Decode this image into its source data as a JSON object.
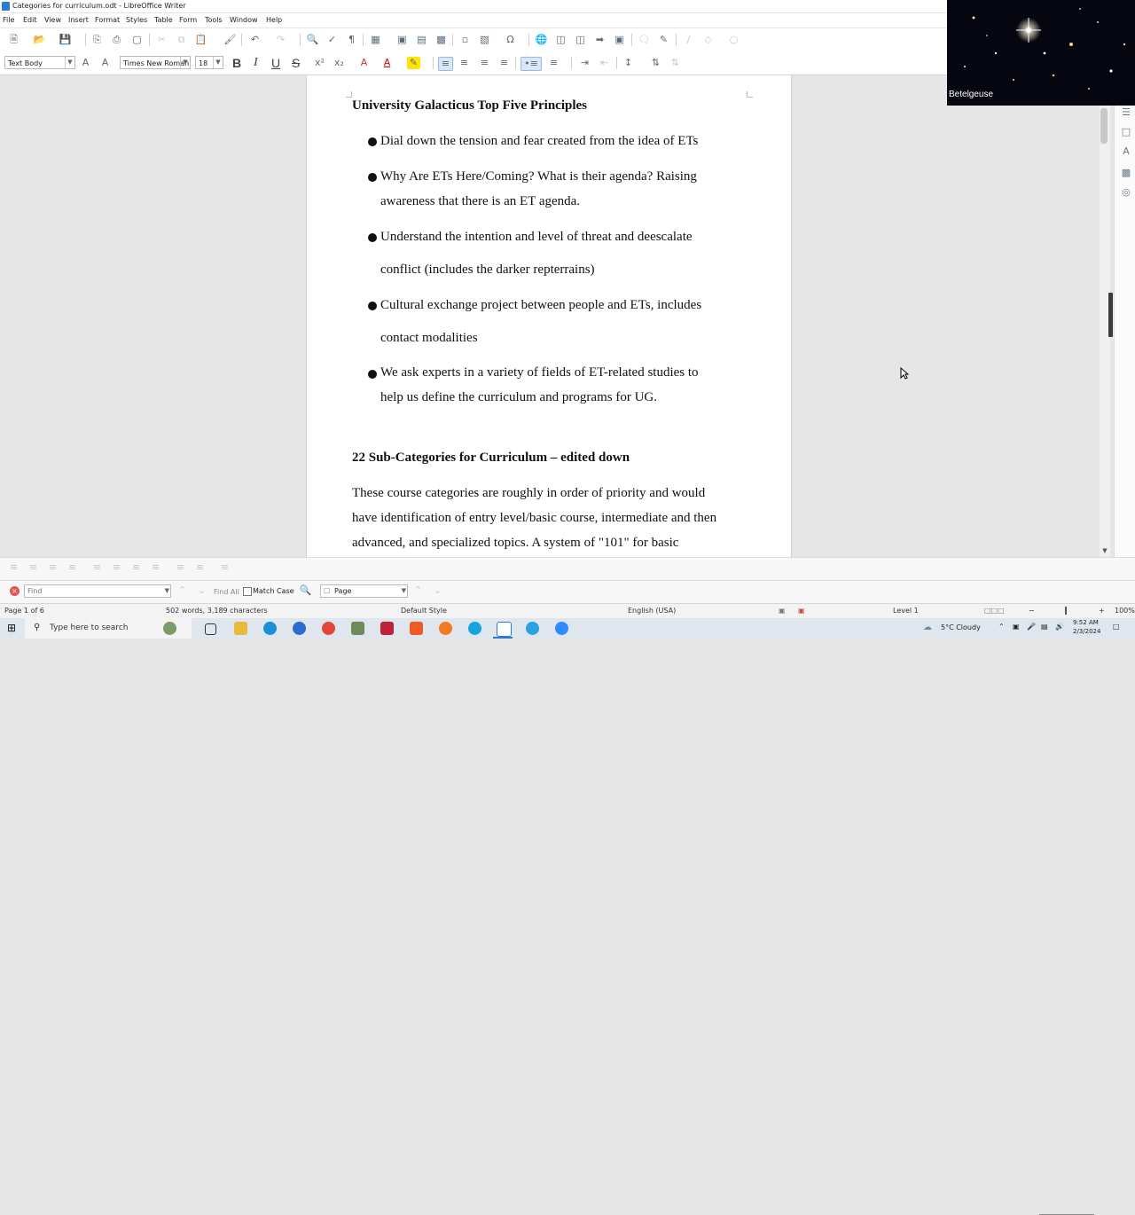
{
  "window": {
    "title": "Categories for curriculum.odt - LibreOffice Writer"
  },
  "menu": [
    "File",
    "Edit",
    "View",
    "Insert",
    "Format",
    "Styles",
    "Table",
    "Form",
    "Tools",
    "Window",
    "Help"
  ],
  "formatting": {
    "paragraph_style": "Text Body",
    "font_name": "Times New Roman",
    "font_size": "18",
    "bold_label": "B",
    "italic_label": "I",
    "underline_label": "U",
    "strike_label": "S"
  },
  "document": {
    "heading1": "University Galacticus Top Five Principles",
    "bullets": [
      [
        "Dial down the tension and fear created from the idea of ETs"
      ],
      [
        "Why Are ETs Here/Coming? What is their agenda? Raising",
        "awareness that there is an ET agenda."
      ],
      [
        "Understand the intention and level of threat and deescalate",
        "conflict (includes the darker repterrains)"
      ],
      [
        "Cultural exchange project between people and ETs, includes",
        "contact modalities"
      ],
      [
        "We ask experts in a variety of fields of ET-related studies to",
        "help us define the curriculum and programs for UG."
      ]
    ],
    "heading2": "22 Sub-Categories for Curriculum – edited down",
    "paragraph_lines": [
      "These course categories are roughly in order of priority and would",
      "have identification of entry level/basic course, intermediate and then",
      "advanced, and specialized topics. A system of \"101\" for basic"
    ]
  },
  "webcam": {
    "label": "Betelgeuse"
  },
  "findbar": {
    "find_placeholder": "Find",
    "find_all": "Find All",
    "match_case": "Match Case",
    "page_option": "Page"
  },
  "status": {
    "page": "Page 1 of 6",
    "counts": "502 words, 3,189 characters",
    "style": "Default Style",
    "language": "English (USA)",
    "level": "Level 1",
    "zoom": "100%"
  },
  "taskbar": {
    "search_placeholder": "Type here to search",
    "weather": "5°C  Cloudy",
    "time": "9:52 AM",
    "date": "2/3/2024"
  },
  "colors": {
    "accent": "#2a7bd4",
    "page_bg": "#ffffff",
    "workspace_bg": "#e6e6e6"
  }
}
